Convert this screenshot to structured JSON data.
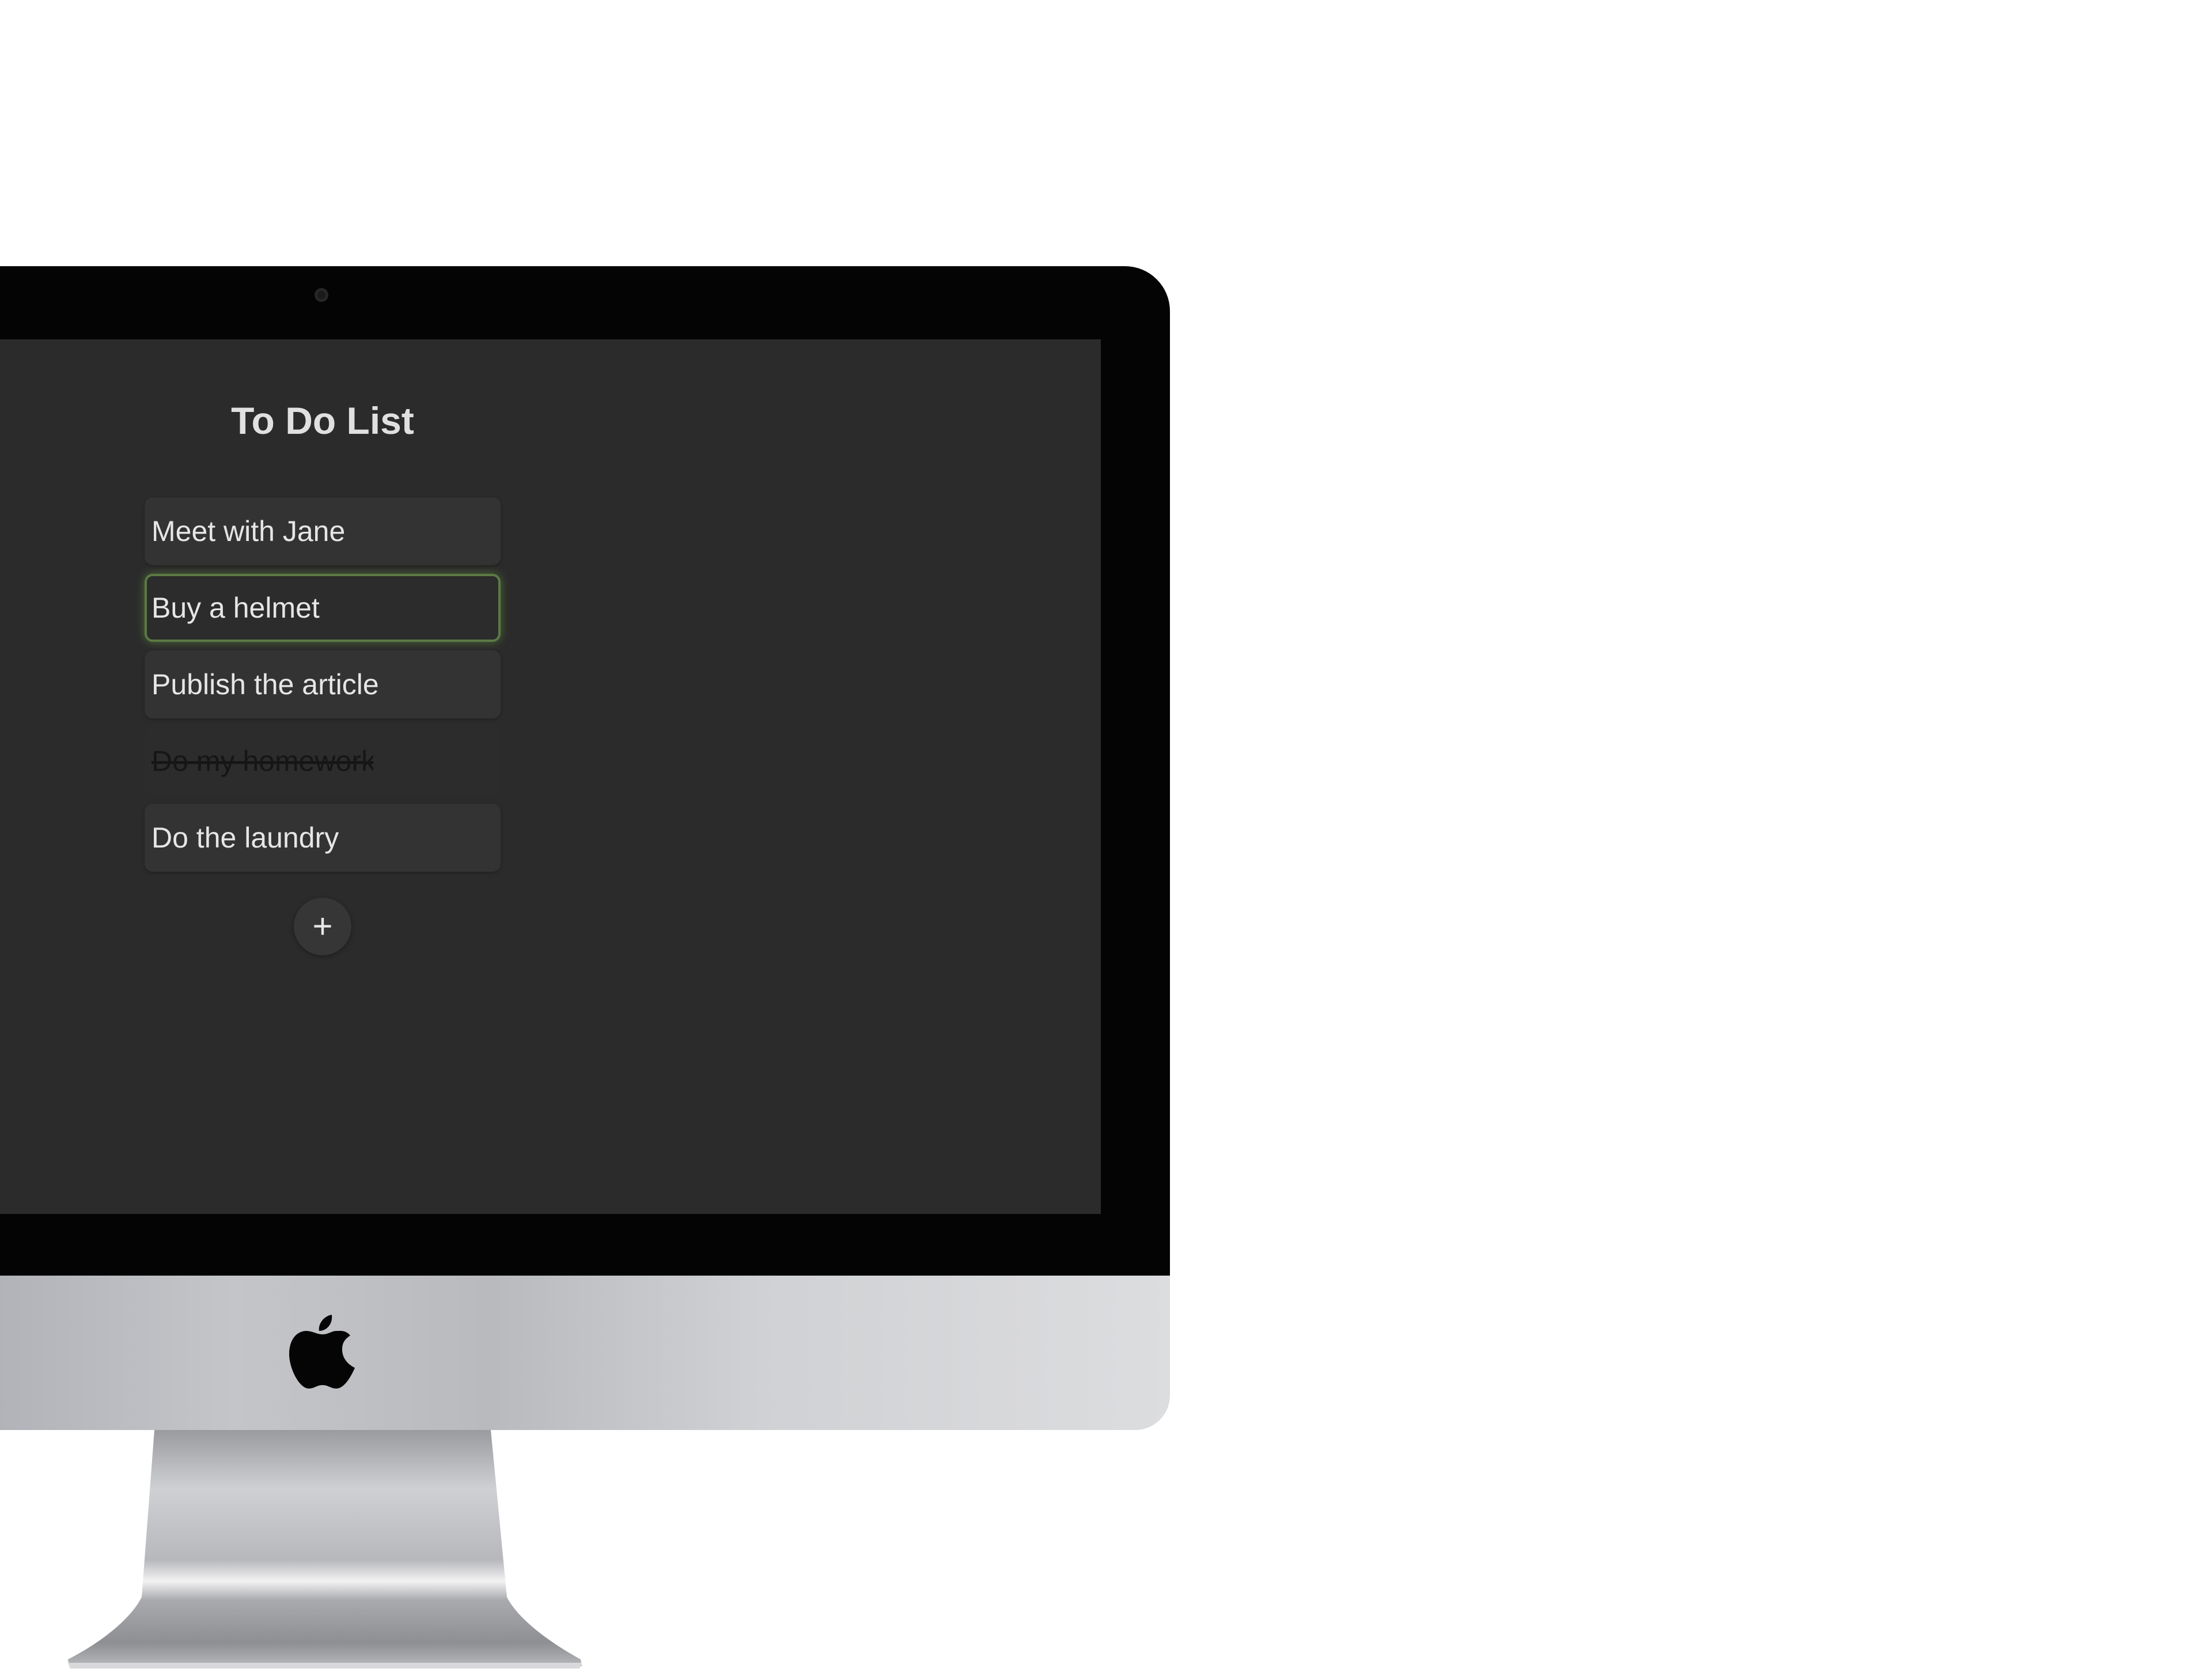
{
  "app": {
    "title": "To Do List"
  },
  "todos": [
    {
      "text": "Meet with Jane",
      "state": "normal"
    },
    {
      "text": "Buy a helmet",
      "state": "focused"
    },
    {
      "text": "Publish the article",
      "state": "normal"
    },
    {
      "text": "Do my homework",
      "state": "done"
    },
    {
      "text": "Do the laundry",
      "state": "normal"
    }
  ],
  "add_button": {
    "label": "+"
  },
  "device": {
    "logo_icon": "apple-logo-icon",
    "camera_icon": "webcam-icon"
  },
  "colors": {
    "screen_background": "#2b2b2b",
    "item_background": "#333333",
    "focus_border": "#5c7a44",
    "text": "#e6e6e6"
  }
}
